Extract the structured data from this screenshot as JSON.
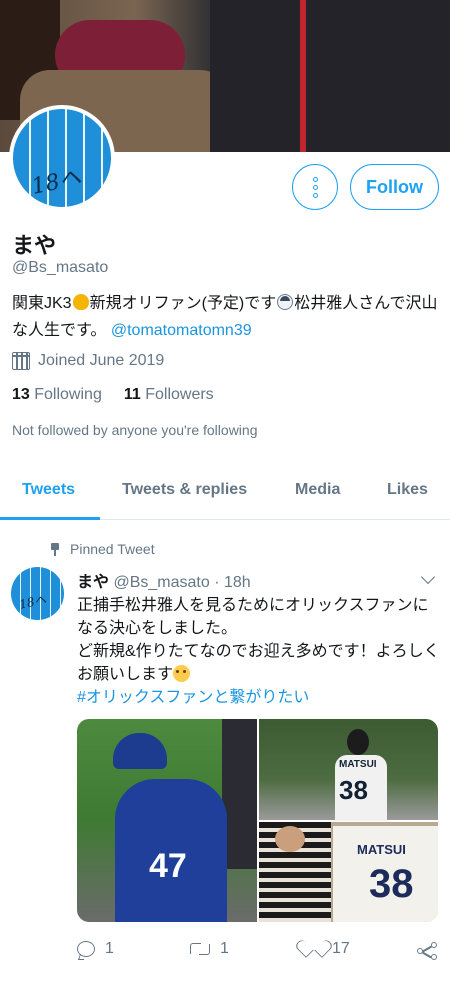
{
  "profile": {
    "name": "まや",
    "handle": "@Bs_masato",
    "bio_part1": "関東JK3",
    "bio_part2": "新規オリファン(予定)です",
    "bio_part3": "松井雅人さんで沢山な人生です。",
    "bio_mention": "@tomatomatomn39",
    "joined": "Joined June 2019",
    "following_count": "13",
    "following_label": "Following",
    "followers_count": "11",
    "followers_label": "Followers",
    "not_followed": "Not followed by anyone you're following",
    "follow_button": "Follow",
    "avatar_scribble": "18ヘ"
  },
  "tabs": [
    {
      "label": "Tweets",
      "active": true
    },
    {
      "label": "Tweets & replies",
      "active": false
    },
    {
      "label": "Media",
      "active": false
    },
    {
      "label": "Likes",
      "active": false
    }
  ],
  "tweet": {
    "pinned_label": "Pinned Tweet",
    "name": "まや",
    "handle": "@Bs_masato",
    "separator": "·",
    "time": "18h",
    "text_line1": "正捕手松井雅人を見るためにオリックスファンになる決心をしました。",
    "text_line2": "ど新規&作りたてなのでお迎え多めです！よろしくお願いします",
    "hashtag": "#オリックスファンと繋がりたい",
    "media": {
      "img1_number": "47",
      "img2_name": "MATSUI",
      "img2_number": "38",
      "img3_name": "MATSUI",
      "img3_number": "38"
    },
    "reply_count": "1",
    "retweet_count": "1",
    "like_count": "17"
  },
  "colors": {
    "accent": "#1da1f2",
    "link": "#1b95e0",
    "secondary_text": "#657786"
  },
  "icons": [
    "more-options-icon",
    "calendar-icon",
    "pin-icon",
    "chevron-down-icon",
    "reply-icon",
    "retweet-icon",
    "heart-icon",
    "share-icon"
  ]
}
